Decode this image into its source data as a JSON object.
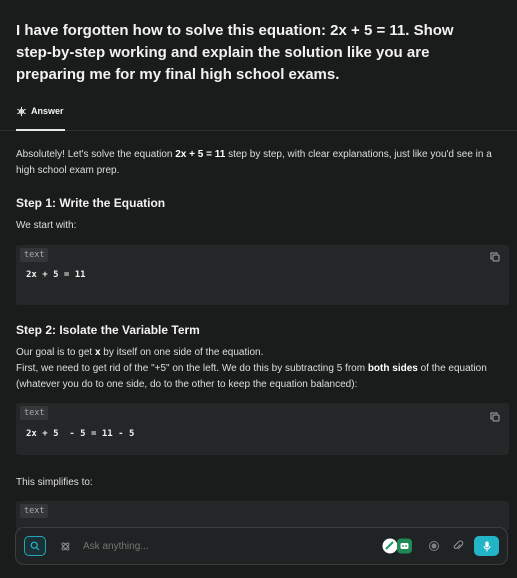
{
  "question": "I have forgotten how to solve this equation: 2x + 5 = 11. Show step-by-step working and explain the solution like you are preparing me for my final high school exams.",
  "tab": {
    "label": "Answer"
  },
  "intro": {
    "pre": "Absolutely! Let's solve the equation ",
    "equation": "2x + 5 = 11",
    "post": " step by step, with clear explanations, just like you'd see in a high school exam prep."
  },
  "step1": {
    "title": "Step 1: Write the Equation",
    "text": "We start with:"
  },
  "code1": {
    "lang": "text",
    "code": "2x + 5 = 11"
  },
  "step2": {
    "title": "Step 2: Isolate the Variable Term",
    "line1_pre": "Our goal is to get ",
    "line1_var": "x",
    "line1_post": " by itself on one side of the equation.",
    "line2_pre": "First, we need to get rid of the \"+5\" on the left. We do this by subtracting 5 from ",
    "line2_bold": "both sides",
    "line2_post": " of the equation (whatever you do to one side, do to the other to keep the equation balanced):"
  },
  "code2": {
    "lang": "text",
    "code": "2x + 5  - 5 = 11 - 5"
  },
  "simplifies": "This simplifies to:",
  "code3": {
    "lang": "text"
  },
  "input": {
    "placeholder": "Ask anything..."
  },
  "colors": {
    "accent": "#22b5c8",
    "background": "#1a1c1c",
    "code_bg": "#242727"
  }
}
